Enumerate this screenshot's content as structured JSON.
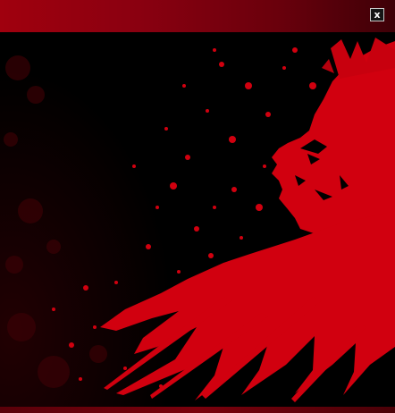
{
  "window": {
    "close_icon": "close-icon",
    "close_glyph": "x"
  },
  "artwork": {
    "description_icon": "blood-splatter-face-illustration"
  },
  "colors": {
    "titlebar": "#a0000e",
    "blood": "#d1000f",
    "background": "#000000"
  }
}
